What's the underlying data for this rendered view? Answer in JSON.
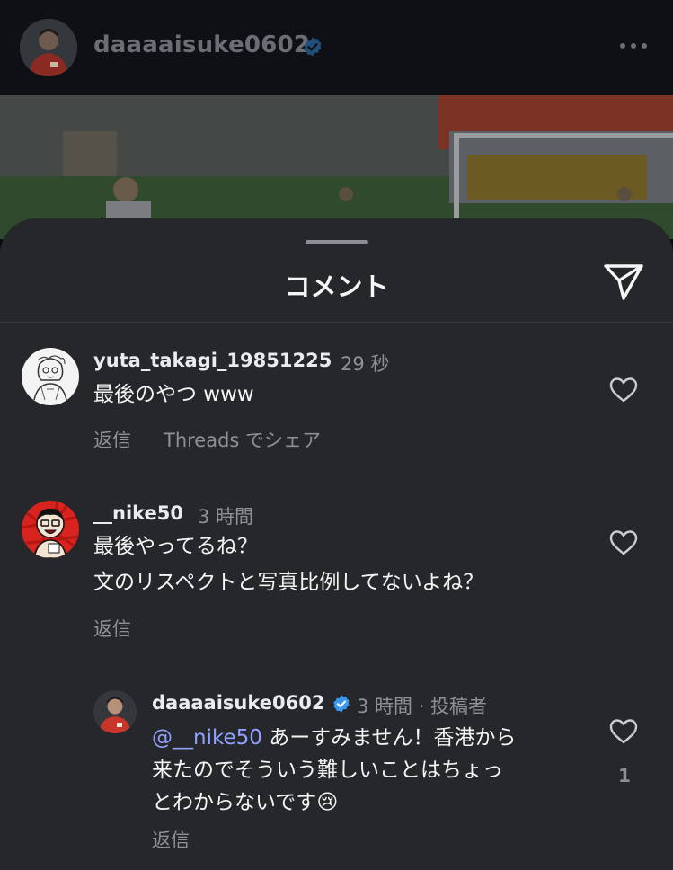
{
  "header": {
    "username": "daaaaisuke0602",
    "verified_icon": "verified-badge-icon",
    "more_icon": "more-horizontal-icon"
  },
  "sheet": {
    "title": "コメント",
    "share_icon": "send-icon"
  },
  "comments": [
    {
      "username": "yuta_takagi_19851225",
      "time": "29 秒",
      "lines": [
        "最後のやつ www"
      ],
      "actions": [
        "返信",
        "Threads でシェア"
      ],
      "avatar_icon": "sketch-avatar-icon"
    },
    {
      "username": "__nike50",
      "time": "3 時間",
      "lines": [
        "最後やってるね？",
        "文のリスペクトと写真比例してないよね？"
      ],
      "actions": [
        "返信"
      ],
      "avatar_icon": "cartoon-avatar-icon"
    }
  ],
  "reply": {
    "username": "daaaaisuke0602",
    "meta": "3 時間 · 投稿者",
    "mention": "@__nike50",
    "line1_rest": " あーすみません！香港から",
    "line2": "来たのでそういう難しいことはちょっ",
    "line3": "とわからないです",
    "emoji": "😢",
    "action": "返信",
    "likes": "1"
  },
  "colors": {
    "sheet_bg": "#25272b",
    "verified_blue": "#3897f0",
    "mention_blue": "#8fa2ff",
    "secondary_text": "#8d9197"
  }
}
